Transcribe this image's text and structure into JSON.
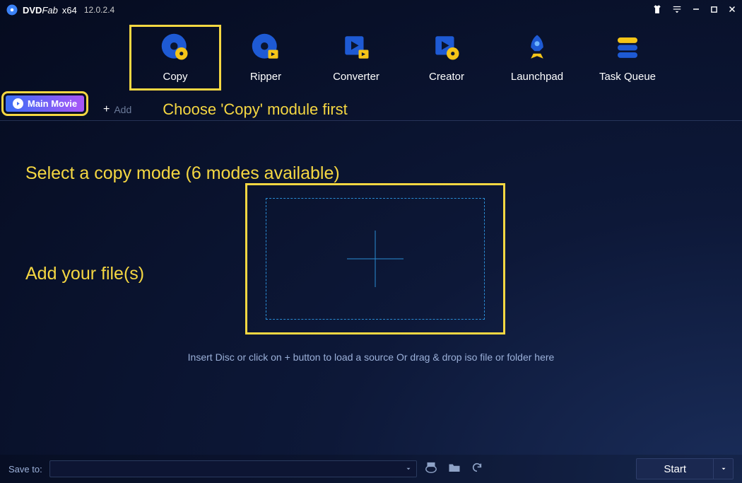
{
  "app": {
    "name_bold": "DVD",
    "name_italic": "Fab",
    "arch": "x64",
    "version": "12.0.2.4"
  },
  "modules": [
    {
      "label": "Copy",
      "selected": true
    },
    {
      "label": "Ripper"
    },
    {
      "label": "Converter"
    },
    {
      "label": "Creator"
    },
    {
      "label": "Launchpad"
    },
    {
      "label": "Task Queue"
    }
  ],
  "submenu": {
    "main_movie": "Main Movie",
    "add": "Add"
  },
  "hints": {
    "choose": "Choose 'Copy' module first",
    "select_mode": "Select a copy mode (6 modes available)",
    "add_file": "Add your file(s)",
    "insert": "Insert Disc or click on + button to load a source Or drag & drop iso file or folder here"
  },
  "bottom": {
    "saveto": "Save to:",
    "start": "Start"
  }
}
